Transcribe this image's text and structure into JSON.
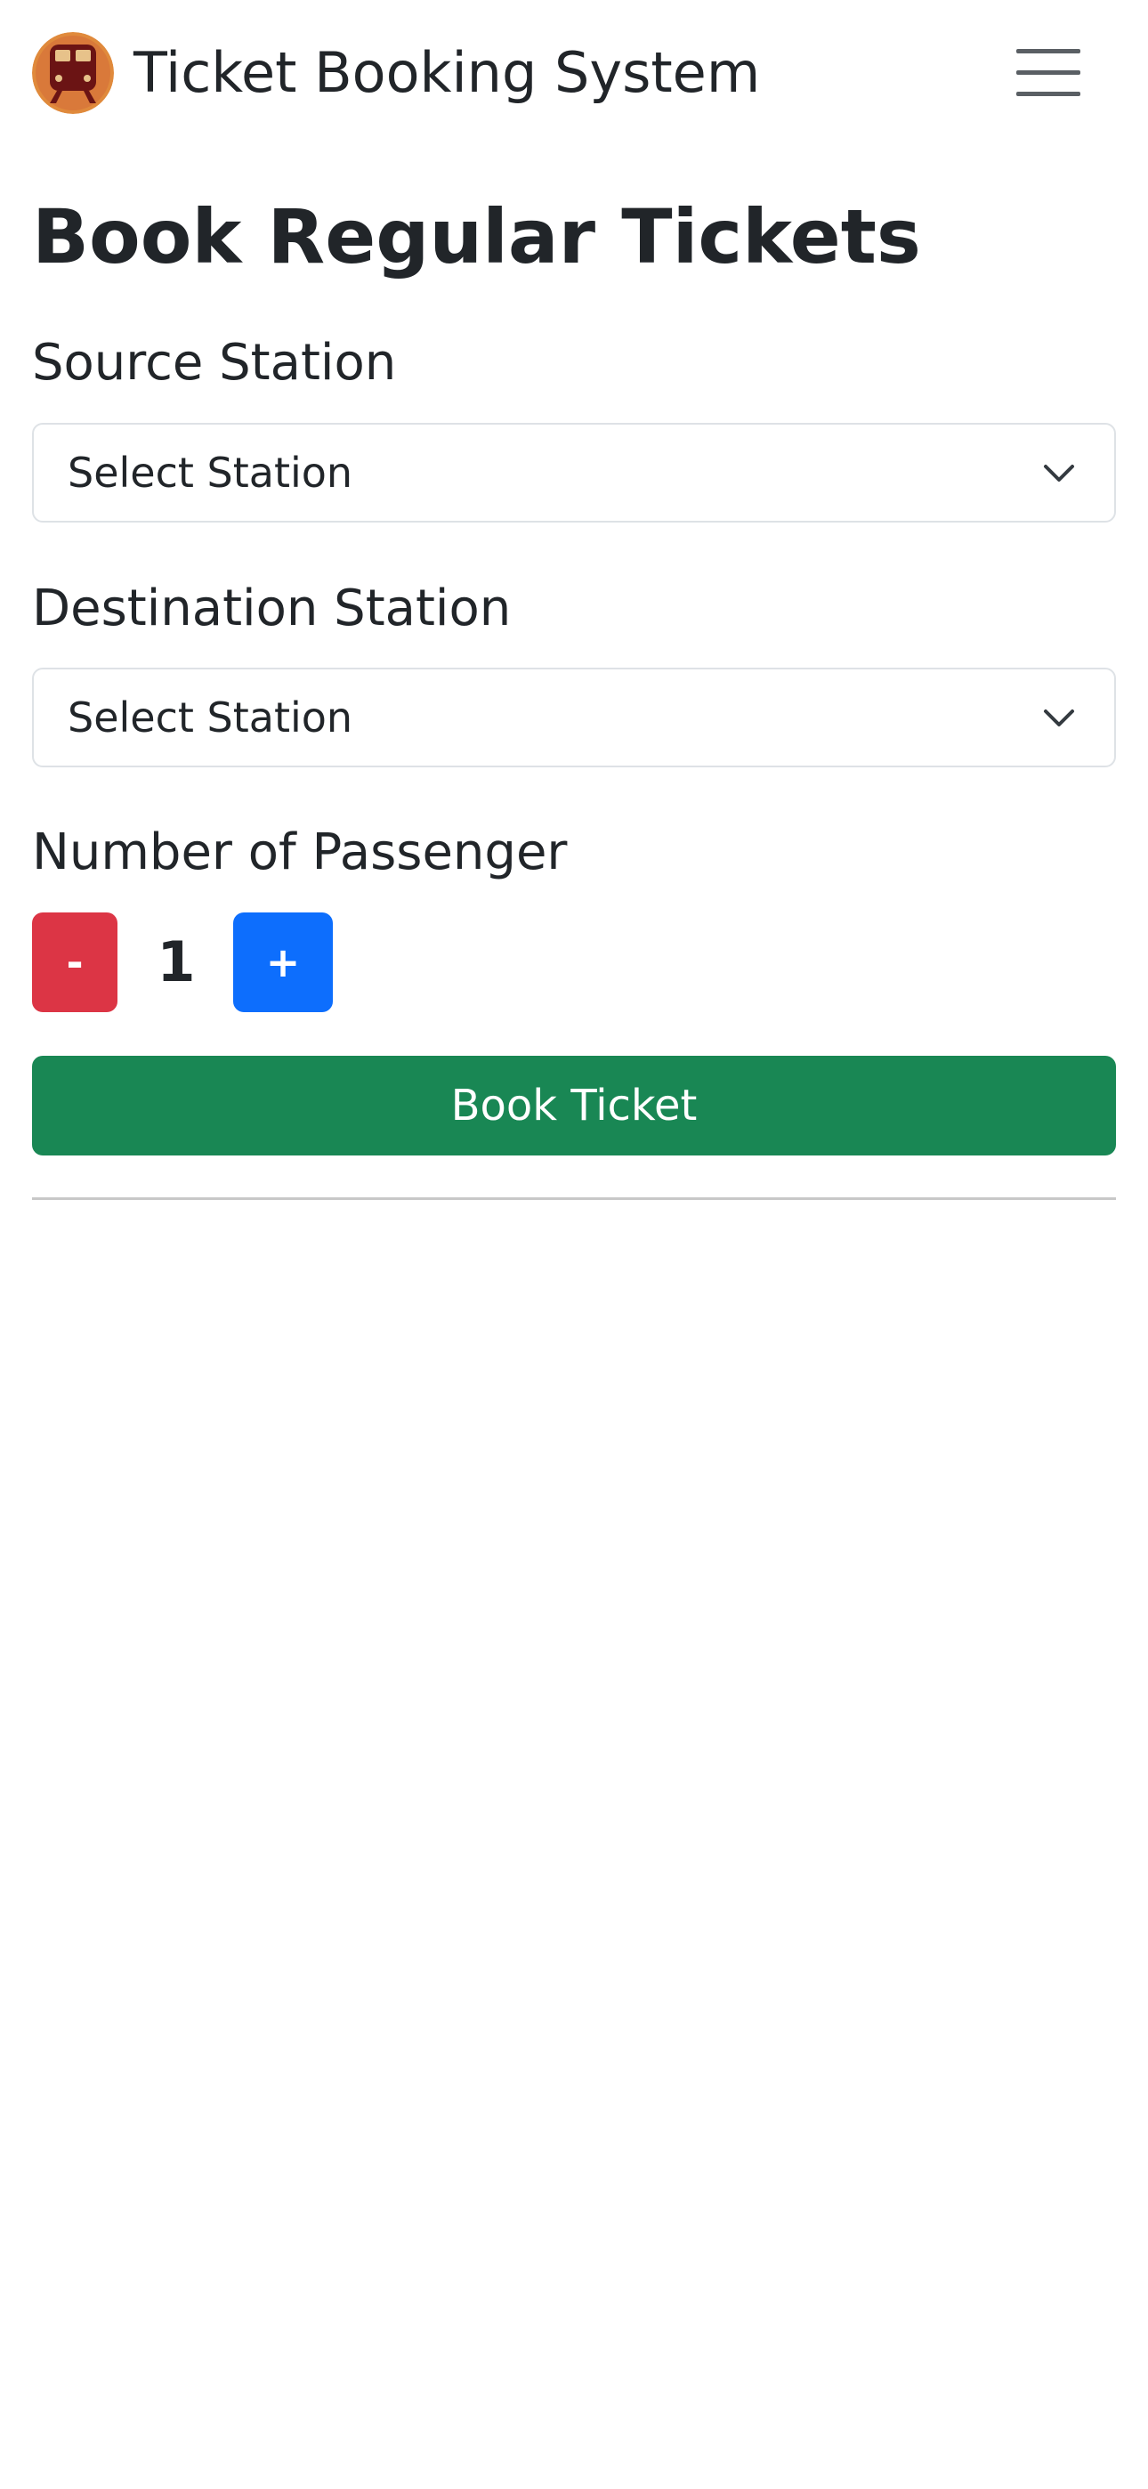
{
  "navbar": {
    "brand_title": "Ticket Booking System",
    "logo_icon": "train-icon",
    "menu_icon": "hamburger-menu-icon"
  },
  "main": {
    "title": "Book Regular Tickets",
    "source": {
      "label": "Source Station",
      "selected": "Select Station"
    },
    "destination": {
      "label": "Destination Station",
      "selected": "Select Station"
    },
    "passengers": {
      "label": "Number of Passenger",
      "decrement_label": "-",
      "increment_label": "+",
      "count": "1"
    },
    "book_button_label": "Book Ticket"
  },
  "colors": {
    "danger": "#dc3545",
    "primary": "#0d6efd",
    "success": "#198754",
    "text": "#212529",
    "logo_bg": "#e08a3c",
    "logo_train": "#6b1414"
  }
}
